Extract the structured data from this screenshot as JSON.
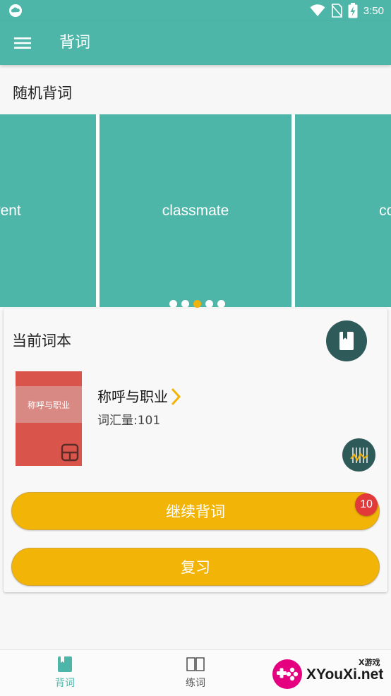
{
  "status_bar": {
    "time": "3:50"
  },
  "app_bar": {
    "title": "背词"
  },
  "random_section": {
    "title": "随机背词",
    "cards": [
      {
        "word": "parent"
      },
      {
        "word": "classmate"
      },
      {
        "word": "cou"
      }
    ],
    "page_count": 5,
    "active_page": 3
  },
  "current_book": {
    "title": "当前词本",
    "cover_label": "称呼与职业",
    "name": "称呼与职业",
    "count_label": "词汇量:101"
  },
  "actions": {
    "continue_label": "继续背词",
    "continue_badge": "10",
    "review_label": "复习"
  },
  "bottom_nav": {
    "items": [
      {
        "label": "背词",
        "icon": "book-icon",
        "active": true
      },
      {
        "label": "练词",
        "icon": "open-book-icon",
        "active": false
      }
    ]
  },
  "watermark": {
    "small": "X游戏",
    "big": "XYouXi.net"
  },
  "colors": {
    "primary": "#4db6a8",
    "accent": "#f2b407",
    "dark": "#2e5a59",
    "badge": "#e23a3a",
    "cover": "#d9554c"
  }
}
